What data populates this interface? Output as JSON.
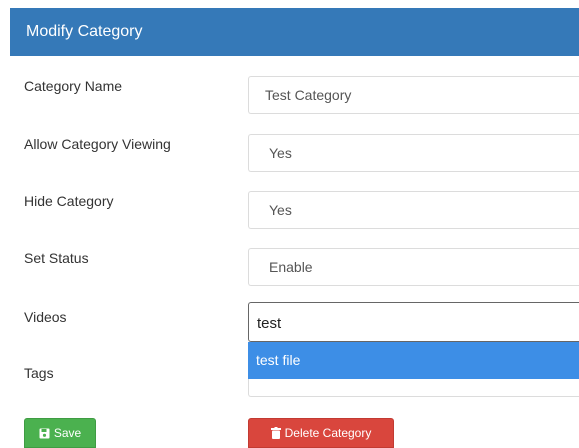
{
  "panel": {
    "title": "Modify Category"
  },
  "form": {
    "category_name": {
      "label": "Category Name",
      "value": "Test Category"
    },
    "allow_viewing": {
      "label": "Allow Category Viewing",
      "value": "Yes"
    },
    "hide_category": {
      "label": "Hide Category",
      "value": "Yes"
    },
    "set_status": {
      "label": "Set Status",
      "value": "Enable"
    },
    "videos": {
      "label": "Videos",
      "value": "test",
      "suggestion": "test file"
    },
    "tags": {
      "label": "Tags"
    }
  },
  "buttons": {
    "save_label": "Save",
    "delete_label": "Delete Category"
  },
  "colors": {
    "header": "#3579b8",
    "suggestion_highlight": "#3d8ee6",
    "save": "#4bb14f",
    "delete": "#d9463d"
  },
  "icons": {
    "save": "floppy-disk-icon",
    "delete": "trash-icon"
  }
}
